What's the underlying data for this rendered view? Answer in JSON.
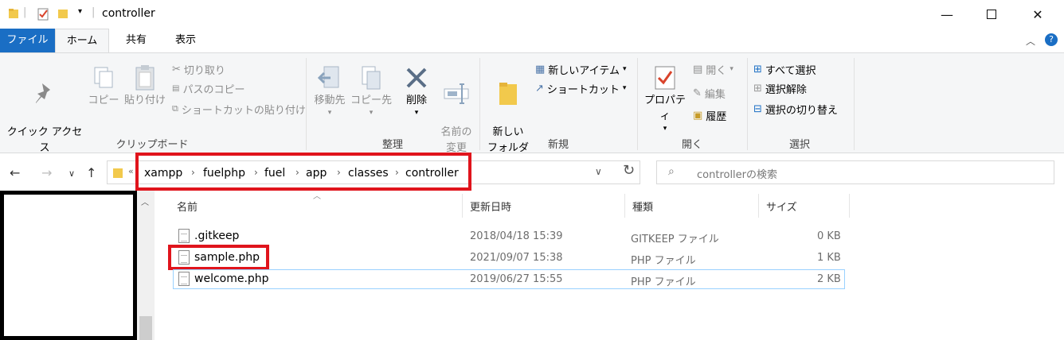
{
  "window": {
    "title": "controller"
  },
  "ribbon_tabs": [
    "ファイル",
    "ホーム",
    "共有",
    "表示"
  ],
  "clipboard": {
    "pin": "クイック アクセス\nにピン留めする",
    "copy": "コピー",
    "paste": "貼り付け",
    "cut": "切り取り",
    "copy_path": "パスのコピー",
    "paste_shortcut": "ショートカットの貼り付け",
    "label": "クリップボード"
  },
  "organize": {
    "move_to": "移動先",
    "copy_to": "コピー先",
    "delete": "削除",
    "rename": "名前の\n変更",
    "label": "整理"
  },
  "new": {
    "new_folder": "新しい\nフォルダー",
    "new_item": "新しいアイテム",
    "shortcut": "ショートカット",
    "label": "新規"
  },
  "open": {
    "properties": "プロパティ",
    "open": "開く",
    "edit": "編集",
    "history": "履歴",
    "label": "開く"
  },
  "select": {
    "select_all": "すべて選択",
    "select_none": "選択解除",
    "invert": "選択の切り替え",
    "label": "選択"
  },
  "address": {
    "crumbs": [
      "xampp",
      "fuelphp",
      "fuel",
      "app",
      "classes",
      "controller"
    ]
  },
  "search": {
    "placeholder": "controllerの検索"
  },
  "columns": {
    "name": "名前",
    "modified": "更新日時",
    "type": "種類",
    "size": "サイズ"
  },
  "files": [
    {
      "name": ".gitkeep",
      "modified": "2018/04/18 15:39",
      "type": "GITKEEP ファイル",
      "size": "0 KB"
    },
    {
      "name": "sample.php",
      "modified": "2021/09/07 15:38",
      "type": "PHP ファイル",
      "size": "1 KB"
    },
    {
      "name": "welcome.php",
      "modified": "2019/06/27 15:55",
      "type": "PHP ファイル",
      "size": "2 KB"
    }
  ],
  "colors": {
    "accent": "#1a6ec4",
    "highlight": "#e0141c"
  }
}
